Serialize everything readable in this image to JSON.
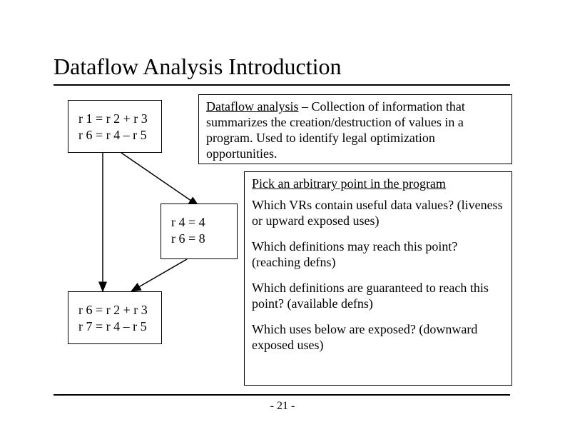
{
  "title": "Dataflow Analysis Introduction",
  "blocks": {
    "a": "r 1 = r 2 + r 3\nr 6 = r 4 – r 5",
    "b": "r 4 = 4\nr 6 = 8",
    "c": "r 6 = r 2 + r 3\nr 7 = r 4 – r 5"
  },
  "definition": {
    "term": "Dataflow analysis",
    "body": " – Collection of information that summarizes the creation/destruction of values in a program.  Used to identify legal optimization opportunities."
  },
  "questions": {
    "head": "Pick an arbitrary point in the program",
    "q1": "Which VRs contain useful  data values? (liveness or upward exposed uses)",
    "q2": "Which definitions may reach this point? (reaching defns)",
    "q3": "Which definitions are guaranteed to reach this point? (available defns)",
    "q4": "Which uses below are exposed? (downward exposed uses)"
  },
  "page_number": "- 21 -"
}
